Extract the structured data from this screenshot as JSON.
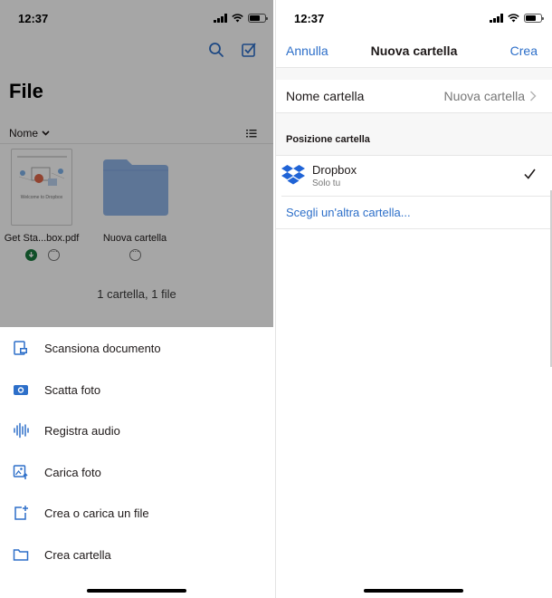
{
  "left_screen": {
    "status_time": "12:37",
    "title": "File",
    "sort_label": "Nome",
    "files": [
      {
        "name": "Get Sta...box.pdf",
        "thumb_text": "Welcome to Dropbox"
      },
      {
        "name": "Nuova cartella"
      }
    ],
    "count_text": "1 cartella, 1 file",
    "actions": [
      {
        "label": "Scansiona documento",
        "icon": "scan-document-icon"
      },
      {
        "label": "Scatta foto",
        "icon": "camera-icon"
      },
      {
        "label": "Registra audio",
        "icon": "audio-wave-icon"
      },
      {
        "label": "Carica foto",
        "icon": "upload-photo-icon"
      },
      {
        "label": "Crea o carica un file",
        "icon": "create-file-icon"
      },
      {
        "label": "Crea cartella",
        "icon": "folder-icon"
      }
    ]
  },
  "right_screen": {
    "status_time": "12:37",
    "nav": {
      "cancel": "Annulla",
      "title": "Nuova cartella",
      "create": "Crea"
    },
    "name_row": {
      "label": "Nome cartella",
      "value": "Nuova cartella"
    },
    "section_title": "Posizione cartella",
    "location": {
      "name": "Dropbox",
      "sub": "Solo tu"
    },
    "choose_other": "Scegli un'altra cartella..."
  },
  "colors": {
    "accent_blue": "#2d6fc9",
    "folder_blue": "#8fb4e6",
    "download_green": "#1a7a3e",
    "overlay": "rgba(0,0,0,0.35)"
  }
}
